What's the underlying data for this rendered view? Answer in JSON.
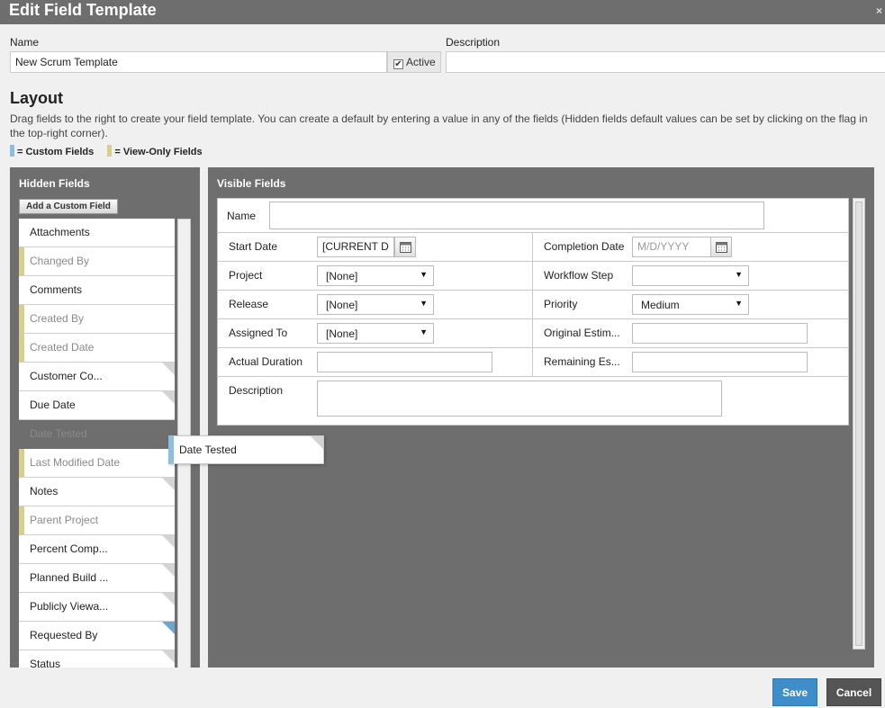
{
  "window": {
    "title": "Edit Field Template",
    "close_glyph": "×"
  },
  "form": {
    "name_label": "Name",
    "name_value": "New Scrum Template",
    "active_label": "Active",
    "active_checked": true,
    "description_label": "Description",
    "description_value": ""
  },
  "layout": {
    "title": "Layout",
    "help": "Drag fields to the right to create your field template. You can create a default by entering a value in any of the fields (Hidden fields default values can be set by clicking on the flag in the top-right corner).",
    "legend_custom": "= Custom Fields",
    "legend_viewonly": "= View-Only Fields",
    "colors": {
      "custom": "#8bbfe0",
      "viewonly": "#d7cf8e",
      "panel": "#6e6e6e",
      "primary": "#3d8ec9"
    }
  },
  "hidden": {
    "title": "Hidden Fields",
    "add_button": "Add a Custom Field",
    "fields": [
      {
        "label": "Attachments",
        "type": "normal",
        "flag": ""
      },
      {
        "label": "Changed By",
        "type": "viewonly",
        "flag": ""
      },
      {
        "label": "Comments",
        "type": "normal",
        "flag": ""
      },
      {
        "label": "Created By",
        "type": "viewonly",
        "flag": ""
      },
      {
        "label": "Created Date",
        "type": "viewonly",
        "flag": ""
      },
      {
        "label": "Customer Co...",
        "type": "normal",
        "flag": "gray"
      },
      {
        "label": "Due Date",
        "type": "normal",
        "flag": "gray"
      },
      {
        "label": "Date Tested",
        "type": "dragging",
        "flag": ""
      },
      {
        "label": "Last Modified Date",
        "type": "viewonly",
        "flag": ""
      },
      {
        "label": "Notes",
        "type": "normal",
        "flag": "gray"
      },
      {
        "label": "Parent Project",
        "type": "viewonly",
        "flag": ""
      },
      {
        "label": "Percent Comp...",
        "type": "normal",
        "flag": "gray"
      },
      {
        "label": "Planned Build ...",
        "type": "normal",
        "flag": "gray"
      },
      {
        "label": "Publicly Viewa...",
        "type": "normal",
        "flag": "gray"
      },
      {
        "label": "Requested By",
        "type": "normal",
        "flag": "blue"
      },
      {
        "label": "Status",
        "type": "normal",
        "flag": "gray"
      }
    ]
  },
  "drag_ghost": {
    "label": "Date Tested"
  },
  "visible": {
    "title": "Visible Fields",
    "name_label": "Name",
    "start_date_label": "Start Date",
    "start_date_value": "[CURRENT D",
    "completion_date_label": "Completion Date",
    "completion_date_placeholder": "M/D/YYYY",
    "project_label": "Project",
    "project_value": "[None]",
    "workflow_step_label": "Workflow Step",
    "workflow_step_value": "",
    "release_label": "Release",
    "release_value": "[None]",
    "priority_label": "Priority",
    "priority_value": "Medium",
    "assigned_to_label": "Assigned To",
    "assigned_to_value": "[None]",
    "original_estimate_label": "Original Estim...",
    "actual_duration_label": "Actual Duration",
    "remaining_estimate_label": "Remaining Es...",
    "description_label": "Description"
  },
  "footer": {
    "save": "Save",
    "cancel": "Cancel"
  }
}
